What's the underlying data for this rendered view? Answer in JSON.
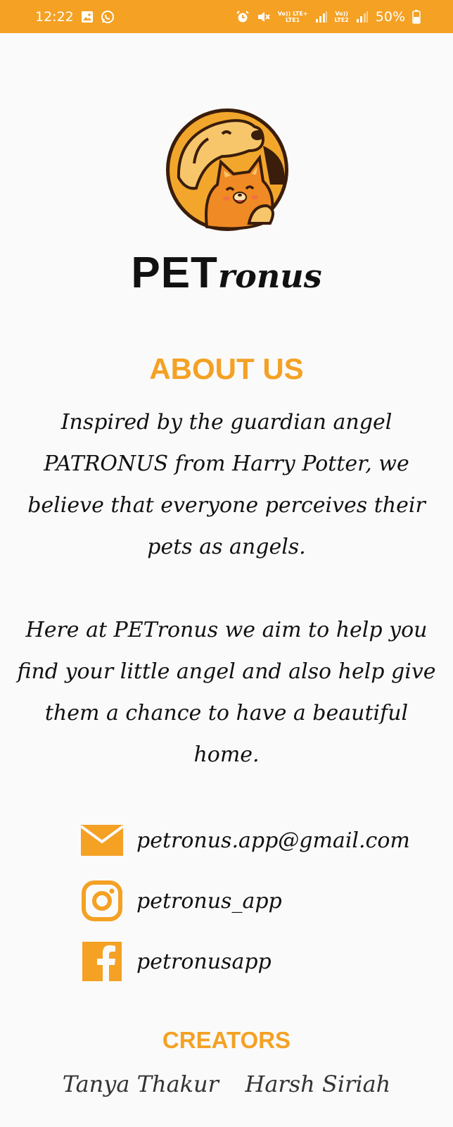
{
  "status_bar": {
    "time": "12:22",
    "left_icons": [
      "gallery-icon",
      "whatsapp-icon"
    ],
    "right_icons": [
      "alarm-icon",
      "mute-icon",
      "signal-icon",
      "signal-icon"
    ],
    "sim1_label_top": "Vo)) LTE+",
    "sim1_label_bottom": "LTE1",
    "sim2_label_top": "Vo))",
    "sim2_label_bottom": "LTE2",
    "battery": "50%",
    "background": "#f4a124"
  },
  "brand": {
    "logo_icon": "dog-and-cat-logo-icon",
    "name_strong": "PET",
    "name_italic": "ronus"
  },
  "about": {
    "heading": "ABOUT US",
    "paragraph1": "Inspired by the guardian angel PATRONUS from Harry Potter, we believe that everyone perceives their pets as angels.",
    "paragraph2": "Here at PETronus we aim to help you find your little angel and also help give them a chance to have a beautiful home."
  },
  "contacts": [
    {
      "icon": "mail-icon",
      "text": "petronus.app@gmail.com"
    },
    {
      "icon": "instagram-icon",
      "text": "petronus_app"
    },
    {
      "icon": "facebook-icon",
      "text": "petronusapp"
    }
  ],
  "creators": {
    "heading": "CREATORS",
    "names": [
      "Tanya Thakur",
      "Harsh Siriah"
    ]
  },
  "colors": {
    "accent": "#f4a124",
    "text": "#111111",
    "background": "#fafafa"
  }
}
